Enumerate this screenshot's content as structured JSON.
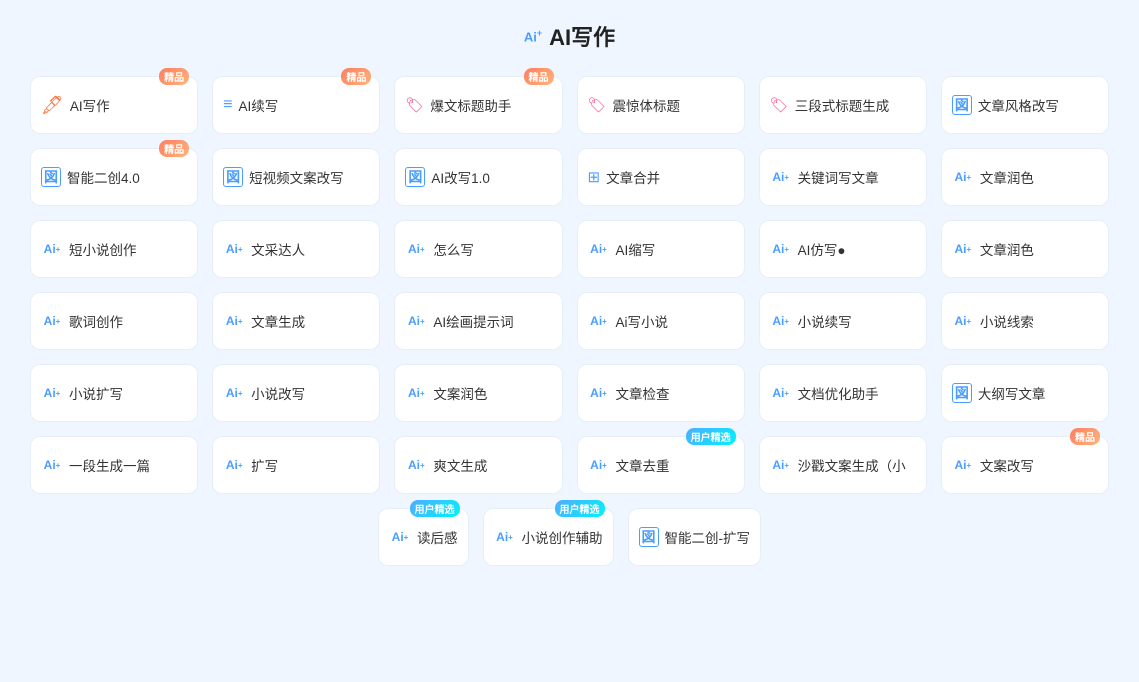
{
  "page": {
    "title": "AI写作",
    "title_prefix": "Ai+"
  },
  "rows": [
    [
      {
        "id": "ai-write",
        "icon": "✍",
        "icon_type": "orange",
        "label": "AI写作",
        "badge": "精品",
        "badge_type": "jingpin"
      },
      {
        "id": "ai-continue",
        "icon": "📝",
        "icon_type": "orange",
        "label": "AI续写",
        "badge": "精品",
        "badge_type": "jingpin"
      },
      {
        "id": "explode-title",
        "icon": "🔥",
        "icon_type": "pink",
        "label": "爆文标题助手",
        "badge": "精品",
        "badge_type": "jingpin"
      },
      {
        "id": "shock-title",
        "icon": "🏷",
        "icon_type": "pink",
        "label": "震惊体标题",
        "badge": "",
        "badge_type": ""
      },
      {
        "id": "three-title",
        "icon": "🏷",
        "icon_type": "pink",
        "label": "三段式标题生成",
        "badge": "",
        "badge_type": ""
      },
      {
        "id": "style-rewrite",
        "icon": "図",
        "icon_type": "blue",
        "label": "文章风格改写",
        "badge": "",
        "badge_type": ""
      }
    ],
    [
      {
        "id": "smart-recreate",
        "icon": "図",
        "icon_type": "blue",
        "label": "智能二创4.0",
        "badge": "精品",
        "badge_type": "jingpin"
      },
      {
        "id": "short-video",
        "icon": "図",
        "icon_type": "blue",
        "label": "短视频文案改写",
        "badge": "",
        "badge_type": ""
      },
      {
        "id": "ai-rewrite",
        "icon": "図",
        "icon_type": "blue",
        "label": "AI改写1.0",
        "badge": "",
        "badge_type": ""
      },
      {
        "id": "article-merge",
        "icon": "⊞",
        "icon_type": "grid",
        "label": "文章合并",
        "badge": "",
        "badge_type": ""
      },
      {
        "id": "keyword-write",
        "icon": "Ai+",
        "icon_type": "ai",
        "label": "关键词写文章",
        "badge": "",
        "badge_type": ""
      },
      {
        "id": "article-polish1",
        "icon": "Ai+",
        "icon_type": "ai",
        "label": "文章润色",
        "badge": "",
        "badge_type": ""
      }
    ],
    [
      {
        "id": "short-novel",
        "icon": "Ai+",
        "icon_type": "ai",
        "label": "短小说创作",
        "badge": "",
        "badge_type": ""
      },
      {
        "id": "writing-style",
        "icon": "Ai+",
        "icon_type": "ai",
        "label": "文采达人",
        "badge": "",
        "badge_type": ""
      },
      {
        "id": "how-write",
        "icon": "Ai+",
        "icon_type": "ai",
        "label": "怎么写",
        "badge": "",
        "badge_type": ""
      },
      {
        "id": "ai-compress",
        "icon": "Ai+",
        "icon_type": "ai",
        "label": "AI缩写",
        "badge": "",
        "badge_type": ""
      },
      {
        "id": "ai-imitate",
        "icon": "Ai+",
        "icon_type": "ai",
        "label": "AI仿写●",
        "badge": "",
        "badge_type": ""
      },
      {
        "id": "article-polish2",
        "icon": "Ai+",
        "icon_type": "ai",
        "label": "文章润色",
        "badge": "",
        "badge_type": ""
      }
    ],
    [
      {
        "id": "lyrics",
        "icon": "Ai+",
        "icon_type": "ai",
        "label": "歌词创作",
        "badge": "",
        "badge_type": ""
      },
      {
        "id": "article-gen",
        "icon": "Ai+",
        "icon_type": "ai",
        "label": "文章生成",
        "badge": "",
        "badge_type": ""
      },
      {
        "id": "ai-draw-prompt",
        "icon": "Ai+",
        "icon_type": "ai",
        "label": "AI绘画提示词",
        "badge": "",
        "badge_type": ""
      },
      {
        "id": "ai-novel",
        "icon": "Ai+",
        "icon_type": "ai",
        "label": "Ai写小说",
        "badge": "",
        "badge_type": ""
      },
      {
        "id": "novel-continue",
        "icon": "Ai+",
        "icon_type": "ai",
        "label": "小说续写",
        "badge": "",
        "badge_type": ""
      },
      {
        "id": "novel-clue",
        "icon": "Ai+",
        "icon_type": "ai",
        "label": "小说线索",
        "badge": "",
        "badge_type": ""
      }
    ],
    [
      {
        "id": "novel-expand",
        "icon": "Ai+",
        "icon_type": "ai",
        "label": "小说扩写",
        "badge": "",
        "badge_type": ""
      },
      {
        "id": "novel-rewrite",
        "icon": "Ai+",
        "icon_type": "ai",
        "label": "小说改写",
        "badge": "",
        "badge_type": ""
      },
      {
        "id": "copy-polish",
        "icon": "Ai+",
        "icon_type": "ai",
        "label": "文案润色",
        "badge": "",
        "badge_type": ""
      },
      {
        "id": "article-check",
        "icon": "Ai+",
        "icon_type": "ai",
        "label": "文章检查",
        "badge": "",
        "badge_type": ""
      },
      {
        "id": "doc-optimize",
        "icon": "Ai+",
        "icon_type": "ai",
        "label": "文档优化助手",
        "badge": "",
        "badge_type": ""
      },
      {
        "id": "outline-write",
        "icon": "図",
        "icon_type": "blue",
        "label": "大纲写文章",
        "badge": "",
        "badge_type": ""
      }
    ],
    [
      {
        "id": "one-para",
        "icon": "Ai+",
        "icon_type": "ai",
        "label": "一段生成一篇",
        "badge": "",
        "badge_type": ""
      },
      {
        "id": "expand-write",
        "icon": "Ai+",
        "icon_type": "ai",
        "label": "扩写",
        "badge": "",
        "badge_type": ""
      },
      {
        "id": "fun-gen",
        "icon": "Ai+",
        "icon_type": "ai",
        "label": "爽文生成",
        "badge": "",
        "badge_type": ""
      },
      {
        "id": "article-remove",
        "icon": "Ai+",
        "icon_type": "ai",
        "label": "文章去重",
        "badge": "用户精选",
        "badge_type": "yonghu"
      },
      {
        "id": "sha-copy",
        "icon": "Ai+",
        "icon_type": "ai",
        "label": "沙戳文案生成（小",
        "badge": "",
        "badge_type": ""
      },
      {
        "id": "copy-rewrite",
        "icon": "Ai+",
        "icon_type": "ai",
        "label": "文案改写",
        "badge": "精品",
        "badge_type": "jingpin"
      }
    ]
  ],
  "last_row": [
    {
      "id": "read-feel",
      "icon": "Ai+",
      "icon_type": "ai",
      "label": "读后感",
      "badge": "用户精选",
      "badge_type": "yonghu"
    },
    {
      "id": "novel-assist",
      "icon": "Ai+",
      "icon_type": "ai",
      "label": "小说创作辅助",
      "badge": "用户精选",
      "badge_type": "yonghu"
    },
    {
      "id": "smart-expand",
      "icon": "図",
      "icon_type": "blue",
      "label": "智能二创-扩写",
      "badge": "",
      "badge_type": ""
    }
  ],
  "badges": {
    "jingpin": "精品",
    "yonghu": "用户精选"
  }
}
